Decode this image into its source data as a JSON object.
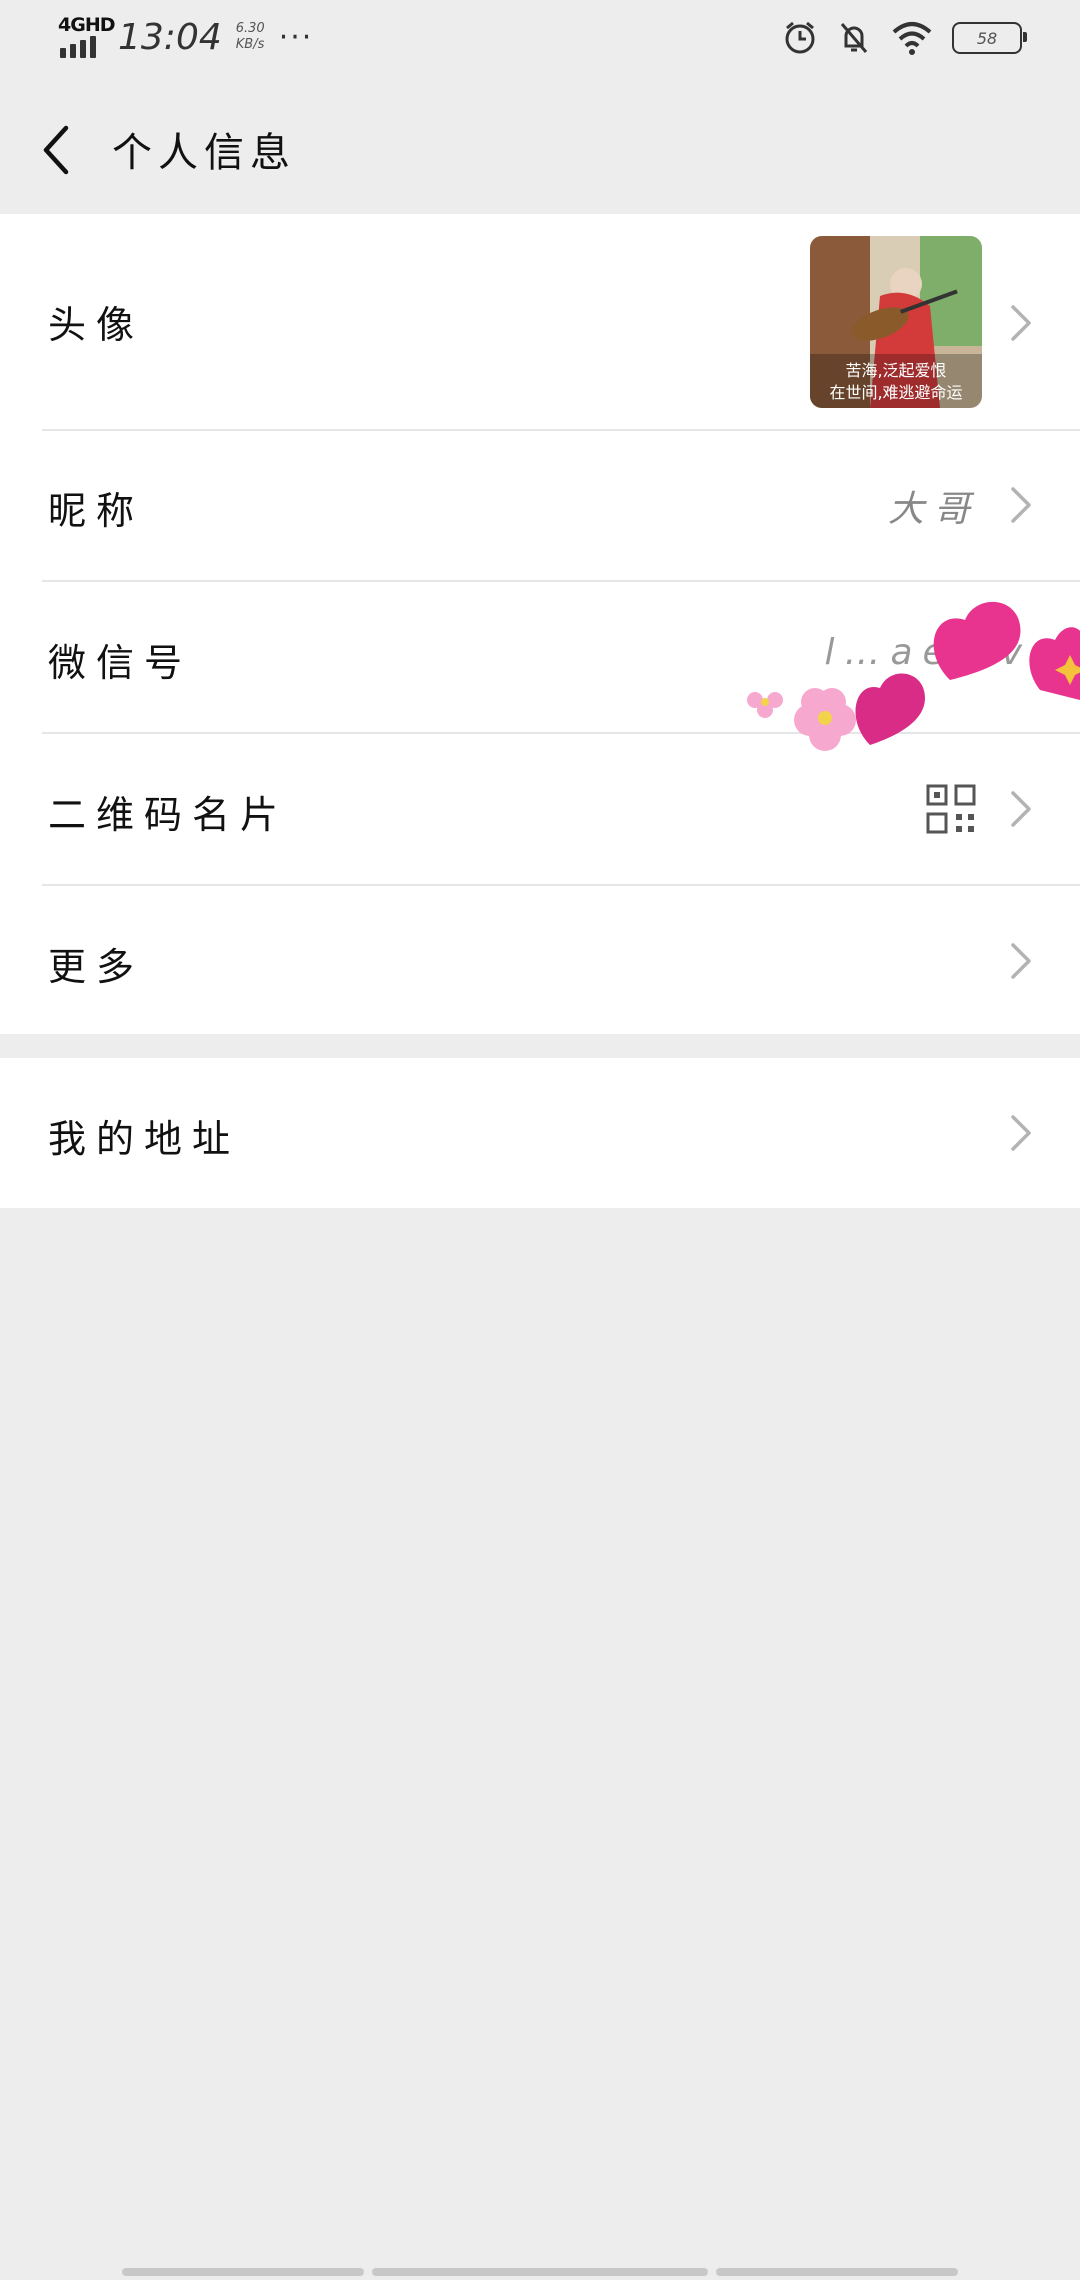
{
  "status_bar": {
    "network": "4GHD",
    "time": "13:04",
    "speed_value": "6.30",
    "speed_unit": "KB/s",
    "more": "···",
    "battery": "58",
    "icons": [
      "signal-icon",
      "alarm-icon",
      "bell-off-icon",
      "wifi-icon",
      "battery-icon"
    ]
  },
  "header": {
    "title": "个人信息",
    "back_icon": "chevron-left-icon"
  },
  "rows": {
    "avatar": {
      "label": "头像",
      "image_caption_line1": "苦海,泛起爱恨",
      "image_caption_line2": "在世间,难逃避命运"
    },
    "nickname": {
      "label": "昵称",
      "value": "大哥"
    },
    "wechat_id": {
      "label": "微信号",
      "value": "l…ae…v"
    },
    "qr_code": {
      "label": "二维码名片",
      "icon": "qr-code-icon"
    },
    "more": {
      "label": "更多"
    },
    "address": {
      "label": "我的地址"
    }
  },
  "colors": {
    "background": "#ededed",
    "card": "#ffffff",
    "divider": "#e6e6e6",
    "chevron": "#b3b3b3",
    "heart": "#e8338f"
  }
}
